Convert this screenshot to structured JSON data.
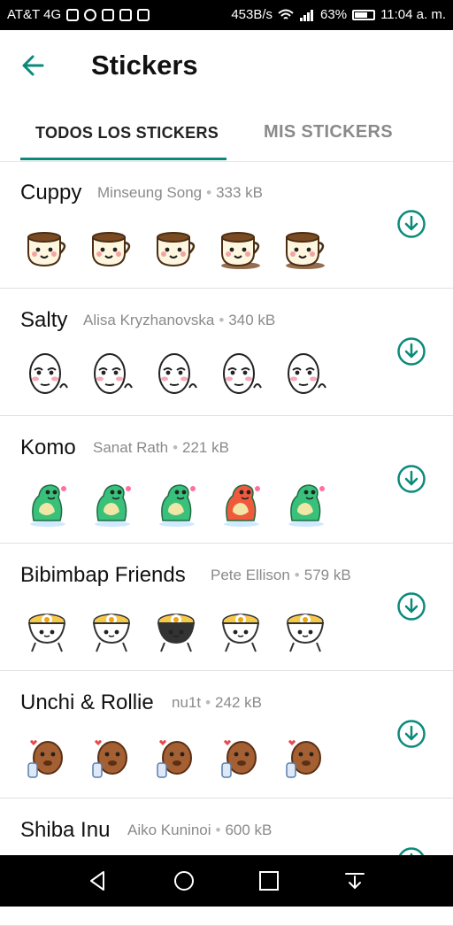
{
  "status_bar": {
    "carrier": "AT&T 4G",
    "speed": "453B/s",
    "battery": "63%",
    "time": "11:04 a. m."
  },
  "header": {
    "title": "Stickers"
  },
  "tabs": [
    {
      "label": "TODOS LOS STICKERS",
      "selected": true
    },
    {
      "label": "MIS STICKERS",
      "selected": false
    }
  ],
  "accent_color": "#0b8a7c",
  "packs": [
    {
      "name": "Cuppy",
      "author": "Minseung Song",
      "size": "333 kB",
      "theme": "cup"
    },
    {
      "name": "Salty",
      "author": "Alisa Kryzhanovska",
      "size": "340 kB",
      "theme": "face"
    },
    {
      "name": "Komo",
      "author": "Sanat Rath",
      "size": "221 kB",
      "theme": "dino"
    },
    {
      "name": "Bibimbap Friends",
      "author": "Pete Ellison",
      "size": "579 kB",
      "theme": "bowl"
    },
    {
      "name": "Unchi & Rollie",
      "author": "nu1t",
      "size": "242 kB",
      "theme": "poop"
    },
    {
      "name": "Shiba Inu",
      "author": "Aiko Kuninoi",
      "size": "600 kB",
      "theme": "dog"
    }
  ],
  "icons": {
    "back": "arrow-left-icon",
    "download": "download-icon",
    "nav": [
      "nav-back-icon",
      "nav-home-icon",
      "nav-recents-icon",
      "nav-notifications-icon"
    ]
  }
}
